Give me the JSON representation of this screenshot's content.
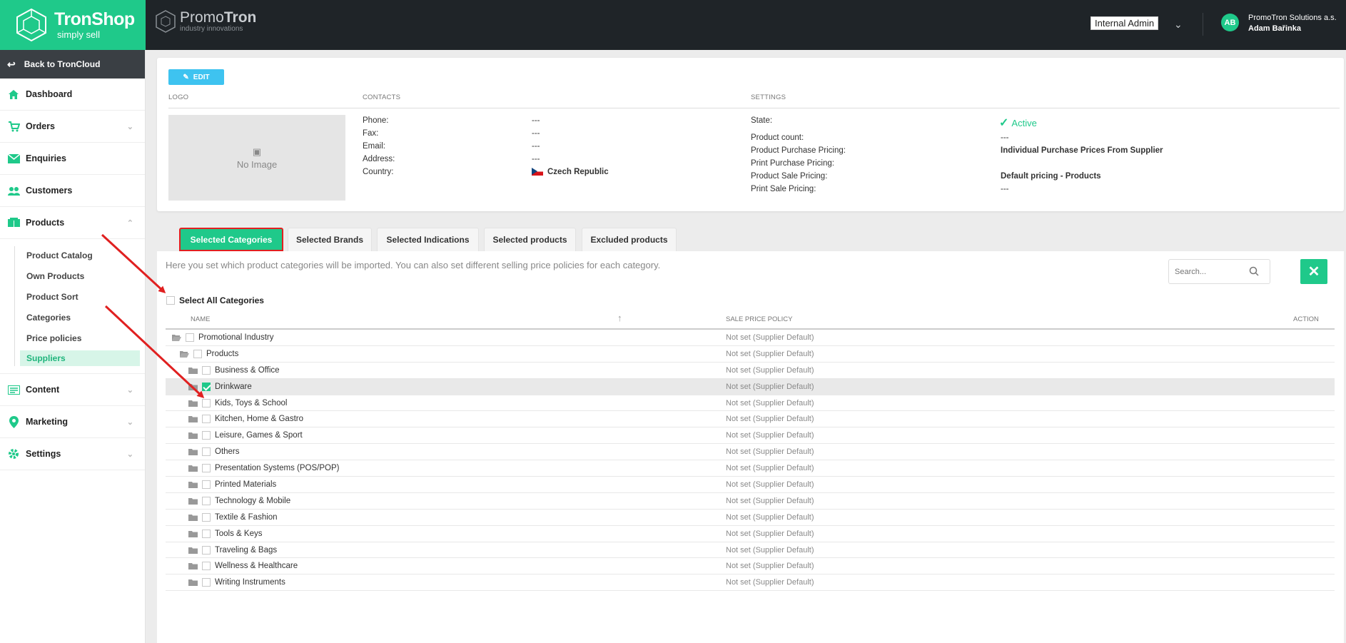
{
  "brand": {
    "name": "TronShop",
    "tagline": "simply sell"
  },
  "header": {
    "partner_name_light": "Promo",
    "partner_name_bold": "Tron",
    "partner_sub": "industry innovations",
    "role": "Internal Admin",
    "avatar_initials": "AB",
    "company": "PromoTron Solutions a.s.",
    "user": "Adam Bařinka"
  },
  "sidebar": {
    "back_label": "Back to TronCloud",
    "items": [
      {
        "label": "Dashboard",
        "icon": "home-icon"
      },
      {
        "label": "Orders",
        "icon": "cart-icon"
      },
      {
        "label": "Enquiries",
        "icon": "envelope-icon"
      },
      {
        "label": "Customers",
        "icon": "users-icon"
      },
      {
        "label": "Products",
        "icon": "boxes-icon"
      },
      {
        "label": "Content",
        "icon": "content-icon"
      },
      {
        "label": "Marketing",
        "icon": "location-pin-icon"
      },
      {
        "label": "Settings",
        "icon": "gear-icon"
      }
    ],
    "product_sub": [
      "Product Catalog",
      "Own Products",
      "Product Sort",
      "Categories",
      "Price policies",
      "Suppliers"
    ]
  },
  "card": {
    "edit_label": "EDIT",
    "logo_label": "LOGO",
    "contacts_label": "CONTACTS",
    "settings_label": "SETTINGS",
    "no_image": "No Image",
    "contacts": [
      {
        "k": "Phone:",
        "v": "---"
      },
      {
        "k": "Fax:",
        "v": "---"
      },
      {
        "k": "Email:",
        "v": "---"
      },
      {
        "k": "Address:",
        "v": "---"
      },
      {
        "k": "Country:",
        "v": "Czech Republic"
      }
    ],
    "settings": [
      {
        "k": "State:",
        "v": "Active"
      },
      {
        "k": "Product count:",
        "v": "---"
      },
      {
        "k": "Product Purchase Pricing:",
        "v": "Individual Purchase Prices From Supplier"
      },
      {
        "k": "Print Purchase Pricing:",
        "v": ""
      },
      {
        "k": "Product Sale Pricing:",
        "v": "Default pricing - Products"
      },
      {
        "k": "Print Sale Pricing:",
        "v": "---"
      }
    ]
  },
  "tabs": [
    "Selected Categories",
    "Selected Brands",
    "Selected Indications",
    "Selected products",
    "Excluded products"
  ],
  "panel": {
    "hint": "Here you set which product categories will be imported. You can also set different selling price policies for each category.",
    "search_placeholder": "Search...",
    "select_all": "Select All Categories",
    "col_name": "NAME",
    "col_policy": "SALE PRICE POLICY",
    "col_action": "ACTION",
    "rows": [
      {
        "name": "Promotional Industry",
        "policy": "Not set (Supplier Default)"
      },
      {
        "name": "Products",
        "policy": "Not set (Supplier Default)"
      },
      {
        "name": "Business & Office",
        "policy": "Not set (Supplier Default)"
      },
      {
        "name": "Drinkware",
        "policy": "Not set (Supplier Default)"
      },
      {
        "name": "Kids, Toys & School",
        "policy": "Not set (Supplier Default)"
      },
      {
        "name": "Kitchen, Home & Gastro",
        "policy": "Not set (Supplier Default)"
      },
      {
        "name": "Leisure, Games & Sport",
        "policy": "Not set (Supplier Default)"
      },
      {
        "name": "Others",
        "policy": "Not set (Supplier Default)"
      },
      {
        "name": "Presentation Systems (POS/POP)",
        "policy": "Not set (Supplier Default)"
      },
      {
        "name": "Printed Materials",
        "policy": "Not set (Supplier Default)"
      },
      {
        "name": "Technology & Mobile",
        "policy": "Not set (Supplier Default)"
      },
      {
        "name": "Textile & Fashion",
        "policy": "Not set (Supplier Default)"
      },
      {
        "name": "Tools & Keys",
        "policy": "Not set (Supplier Default)"
      },
      {
        "name": "Traveling & Bags",
        "policy": "Not set (Supplier Default)"
      },
      {
        "name": "Wellness & Healthcare",
        "policy": "Not set (Supplier Default)"
      },
      {
        "name": "Writing Instruments",
        "policy": "Not set (Supplier Default)"
      }
    ]
  },
  "colors": {
    "brand_green": "#1fc98a",
    "topbar": "#1f2428",
    "edit_blue": "#3ec3f0",
    "annotation_red": "#e02020"
  }
}
